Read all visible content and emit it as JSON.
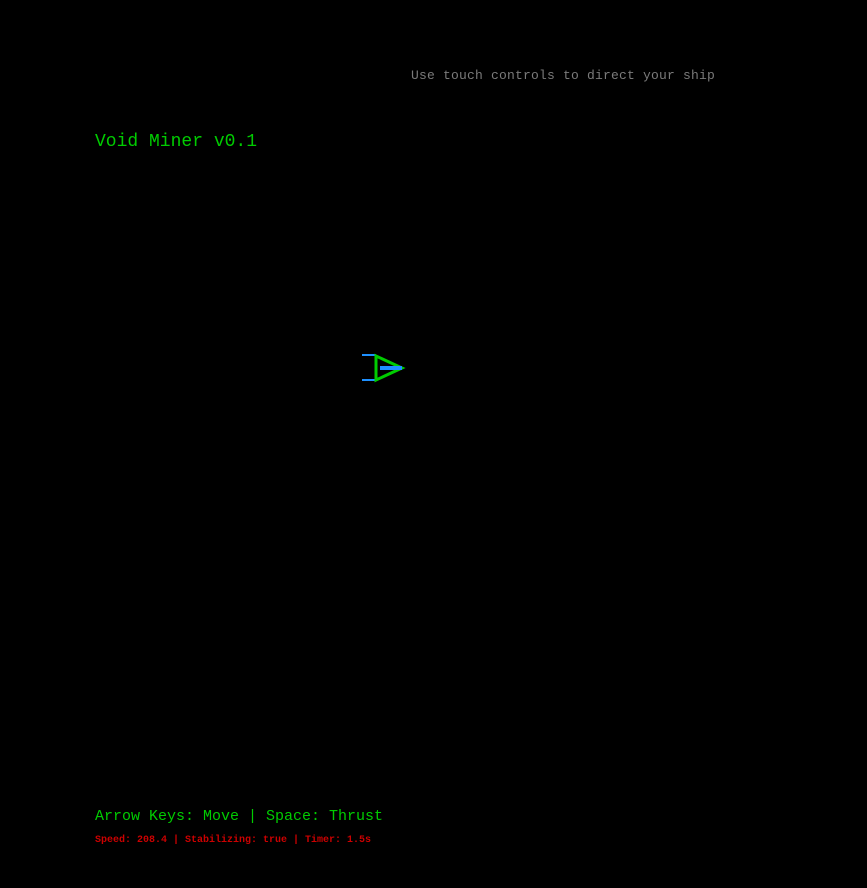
{
  "hint": {
    "text": "Use touch controls to direct your ship"
  },
  "title": {
    "text": "Void Miner v0.1"
  },
  "ship": {
    "icon": "ship-icon",
    "hull_color": "#00cc00",
    "thruster_color": "#1e90ff"
  },
  "footer": {
    "controls_text": "Arrow Keys: Move | Space: Thrust",
    "status_text": "Speed: 208.4 | Stabilizing: true | Timer: 1.5s"
  },
  "colors": {
    "background": "#000000",
    "primary_text": "#00cc00",
    "hint_text": "#7a7a7a",
    "status_text": "#cc0000"
  }
}
